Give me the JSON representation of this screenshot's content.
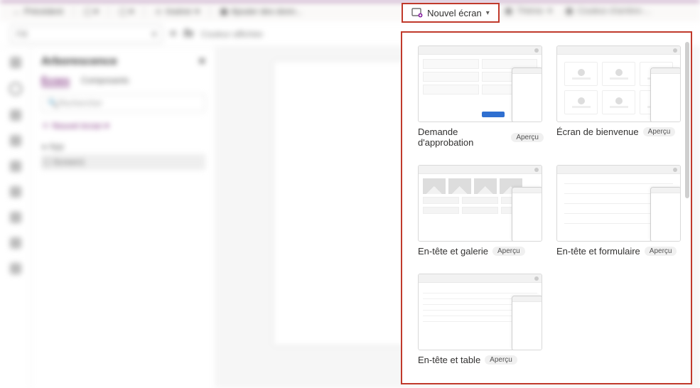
{
  "toolbar": {
    "back_label": "Précédent",
    "insert_label": "Insérer",
    "add_data_label": "Ajouter des donn...",
    "new_screen_label": "Nouvel écran",
    "theme_label": "Thème",
    "bg_color_label": "Couleur d'arrière-..."
  },
  "formula": {
    "property": "Fill",
    "fx_label": "fx",
    "value_hint": "Couleur affichée"
  },
  "tree": {
    "title": "Arborescence",
    "tab_screens": "Écrans",
    "tab_components": "Composants",
    "search_placeholder": "Rechercher",
    "new_screen": "Nouvel écran",
    "item_app": "App",
    "item_screen1": "Screen1"
  },
  "dropdown": {
    "badge": "Aperçu",
    "templates": [
      {
        "name": "Demande d'approbation"
      },
      {
        "name": "Écran de bienvenue"
      },
      {
        "name": "En-tête et galerie"
      },
      {
        "name": "En-tête et formulaire"
      },
      {
        "name": "En-tête et table"
      }
    ]
  }
}
